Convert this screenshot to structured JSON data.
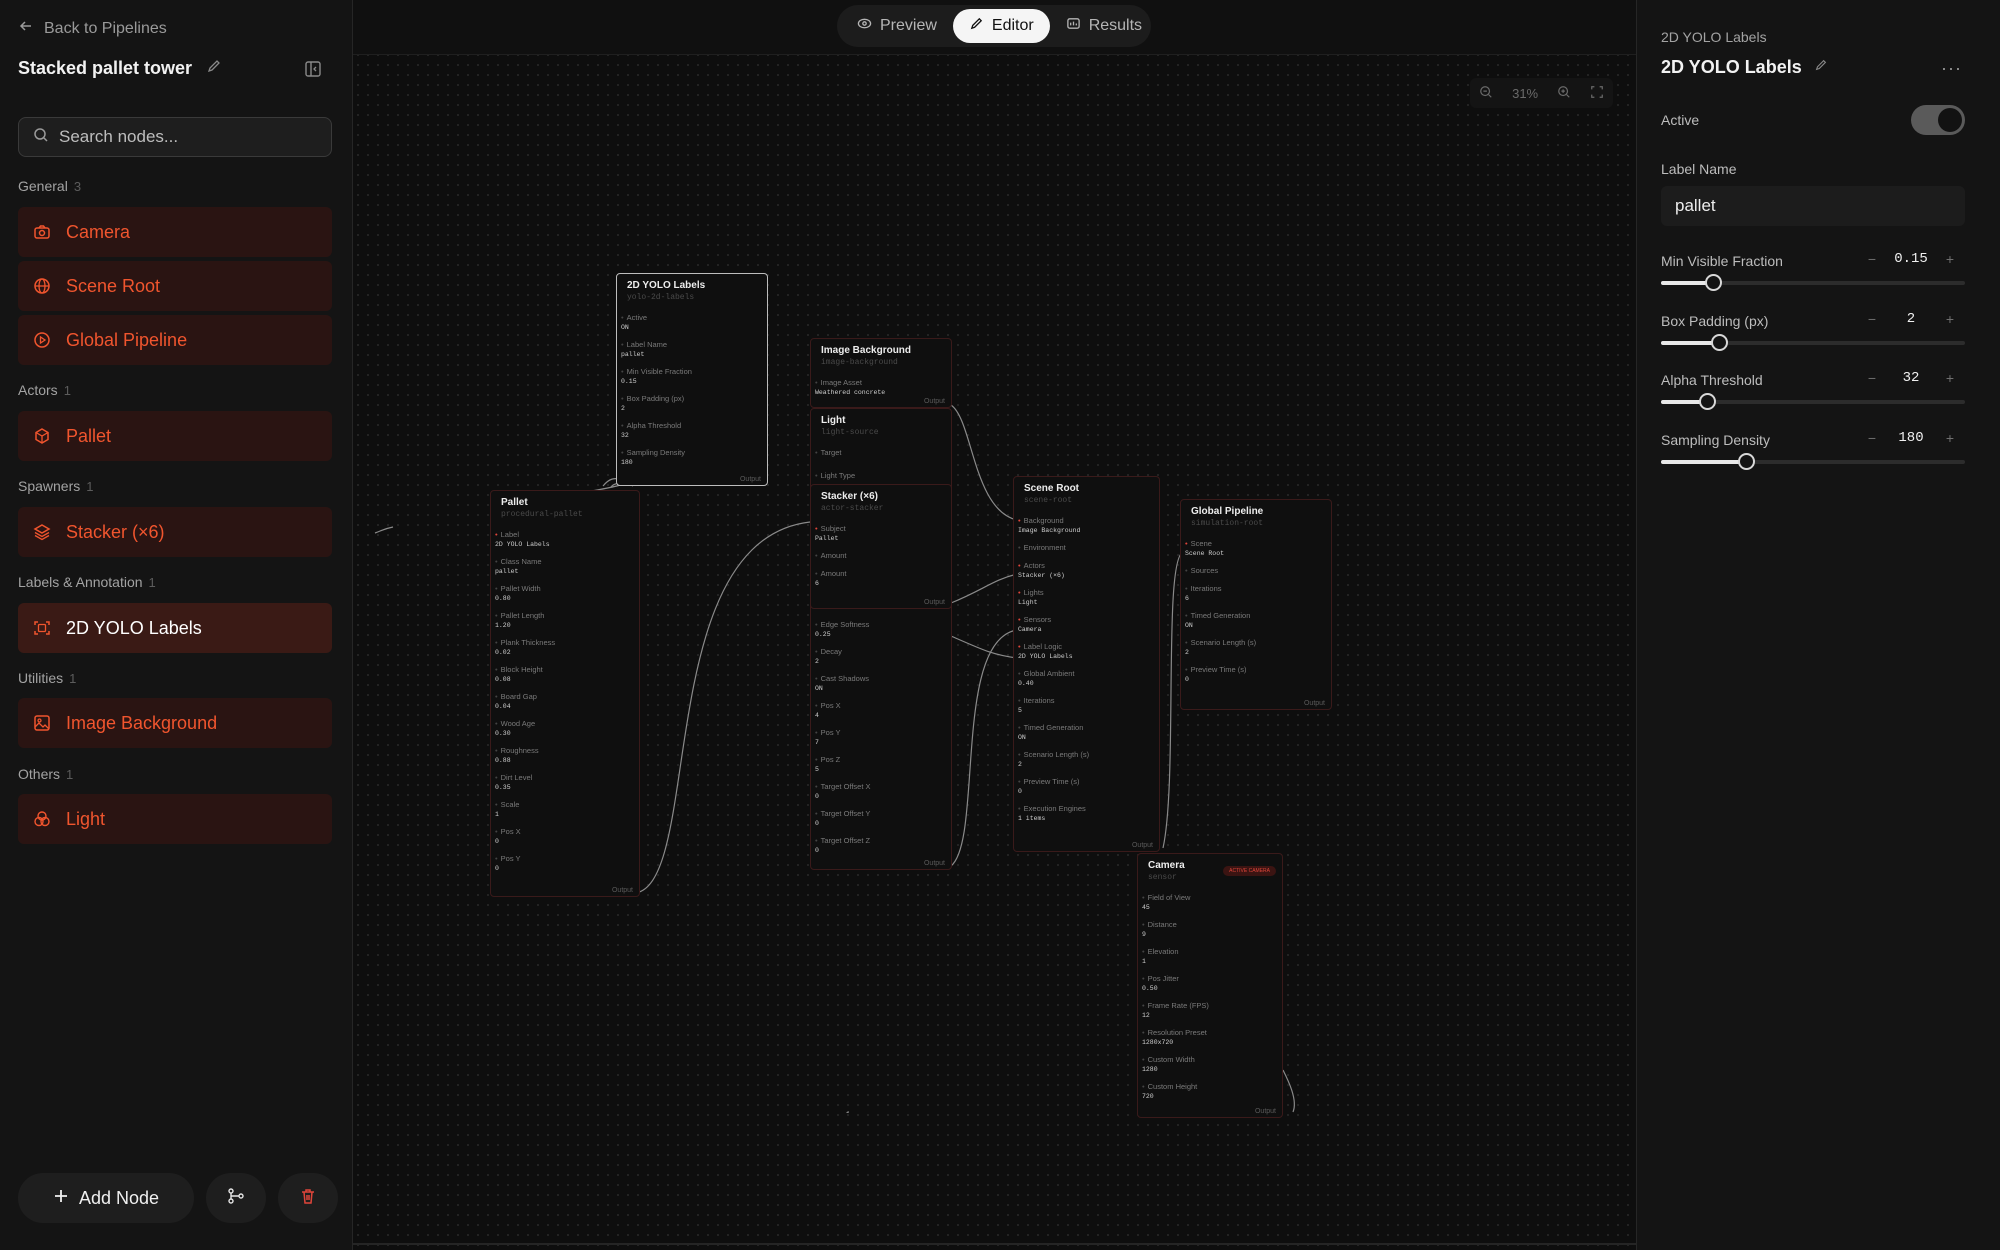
{
  "sidebar": {
    "back_label": "Back to Pipelines",
    "project_name": "Stacked pallet tower",
    "search_placeholder": "Search nodes...",
    "groups": [
      {
        "label": "General",
        "count": "3"
      },
      {
        "label": "Actors",
        "count": "1"
      },
      {
        "label": "Spawners",
        "count": "1"
      },
      {
        "label": "Labels & Annotation",
        "count": "1"
      },
      {
        "label": "Utilities",
        "count": "1"
      },
      {
        "label": "Others",
        "count": "1"
      }
    ],
    "items": [
      {
        "label": "Camera",
        "icon": "camera-icon"
      },
      {
        "label": "Scene Root",
        "icon": "globe-icon"
      },
      {
        "label": "Global Pipeline",
        "icon": "play-circle-icon"
      },
      {
        "label": "Pallet",
        "icon": "box-icon"
      },
      {
        "label": "Stacker (×6)",
        "icon": "layers-icon"
      },
      {
        "label": "2D YOLO Labels",
        "icon": "scan-icon"
      },
      {
        "label": "Image Background",
        "icon": "image-icon"
      },
      {
        "label": "Light",
        "icon": "circles-icon"
      }
    ],
    "add_node_label": "Add Node"
  },
  "toolbar": {
    "tabs": [
      {
        "label": "Preview",
        "icon": "eye-icon"
      },
      {
        "label": "Editor",
        "icon": "pencil-icon"
      },
      {
        "label": "Results",
        "icon": "results-icon"
      }
    ],
    "active_tab": "Editor",
    "zoom": "31%"
  },
  "graph": {
    "yolo": {
      "title": "2D YOLO Labels",
      "type": "yolo-2d-labels",
      "params": [
        [
          "Active",
          "ON"
        ],
        [
          "Label Name",
          "pallet"
        ],
        [
          "Min Visible Fraction",
          "0.15"
        ],
        [
          "Box Padding (px)",
          "2"
        ],
        [
          "Alpha Threshold",
          "32"
        ],
        [
          "Sampling Density",
          "180"
        ]
      ],
      "output": "Output"
    },
    "imgbg": {
      "title": "Image Background",
      "type": "image-background",
      "params": [
        [
          "Image Asset",
          "Weathered concrete"
        ]
      ],
      "output": "Output"
    },
    "light": {
      "title": "Light",
      "type": "light-source",
      "params": [
        [
          "Target",
          ""
        ],
        [
          "Light Type",
          ""
        ]
      ]
    },
    "stacker": {
      "title": "Stacker (×6)",
      "type": "actor-stacker",
      "params": [
        [
          "Subject",
          "Pallet"
        ],
        [
          "Amount",
          ""
        ],
        [
          "Amount",
          "6"
        ]
      ],
      "output": "Output"
    },
    "light_more": {
      "params": [
        [
          "Edge Softness",
          "0.25"
        ],
        [
          "Decay",
          "2"
        ],
        [
          "Cast Shadows",
          "ON"
        ],
        [
          "Pos X",
          "4"
        ],
        [
          "Pos Y",
          "7"
        ],
        [
          "Pos Z",
          "5"
        ],
        [
          "Target Offset X",
          "0"
        ],
        [
          "Target Offset Y",
          "0"
        ],
        [
          "Target Offset Z",
          "0"
        ]
      ],
      "output": "Output"
    },
    "pallet": {
      "title": "Pallet",
      "type": "procedural-pallet",
      "params": [
        [
          "Label",
          "2D YOLO Labels"
        ],
        [
          "Class Name",
          "pallet"
        ],
        [
          "Pallet Width",
          "0.80"
        ],
        [
          "Pallet Length",
          "1.20"
        ],
        [
          "Plank Thickness",
          "0.02"
        ],
        [
          "Block Height",
          "0.08"
        ],
        [
          "Board Gap",
          "0.04"
        ],
        [
          "Wood Age",
          "0.30"
        ],
        [
          "Roughness",
          "0.88"
        ],
        [
          "Dirt Level",
          "0.35"
        ],
        [
          "Scale",
          "1"
        ],
        [
          "Pos X",
          "0"
        ],
        [
          "Pos Y",
          "0"
        ]
      ],
      "output": "Output"
    },
    "scene": {
      "title": "Scene Root",
      "type": "scene-root",
      "params": [
        [
          "Background",
          "Image Background"
        ],
        [
          "Environment",
          ""
        ],
        [
          "Actors",
          "Stacker (×6)"
        ],
        [
          "Lights",
          "Light"
        ],
        [
          "Sensors",
          "Camera"
        ],
        [
          "Label Logic",
          "2D YOLO Labels"
        ],
        [
          "Global Ambient",
          "0.40"
        ],
        [
          "Iterations",
          "5"
        ],
        [
          "Timed Generation",
          "ON"
        ],
        [
          "Scenario Length (s)",
          "2"
        ],
        [
          "Preview Time (s)",
          "0"
        ],
        [
          "Execution Engines",
          "1 items"
        ]
      ],
      "output": "Output"
    },
    "global": {
      "title": "Global Pipeline",
      "type": "simulation-root",
      "params": [
        [
          "Scene",
          "Scene Root"
        ],
        [
          "Sources",
          ""
        ],
        [
          "Iterations",
          "6"
        ],
        [
          "Timed Generation",
          "ON"
        ],
        [
          "Scenario Length (s)",
          "2"
        ],
        [
          "Preview Time (s)",
          "0"
        ]
      ],
      "output": "Output"
    },
    "camera": {
      "title": "Camera",
      "type": "sensor",
      "badge": "ACTIVE CAMERA",
      "params": [
        [
          "Field of View",
          "45"
        ],
        [
          "Distance",
          "9"
        ],
        [
          "Elevation",
          "1"
        ],
        [
          "Pos Jitter",
          "0.50"
        ],
        [
          "Frame Rate (FPS)",
          "12"
        ],
        [
          "Resolution Preset",
          "1280x720"
        ],
        [
          "Custom Width",
          "1280"
        ],
        [
          "Custom Height",
          "720"
        ]
      ],
      "output": "Output"
    }
  },
  "inspector": {
    "subtitle": "2D YOLO Labels",
    "title": "2D YOLO Labels",
    "active_label": "Active",
    "active": true,
    "label_name_label": "Label Name",
    "label_name_value": "pallet",
    "fields": [
      {
        "label": "Min Visible Fraction",
        "value": "0.15",
        "level": 0.17
      },
      {
        "label": "Box Padding (px)",
        "value": "2",
        "level": 0.19
      },
      {
        "label": "Alpha Threshold",
        "value": "32",
        "level": 0.15
      },
      {
        "label": "Sampling Density",
        "value": "180",
        "level": 0.28
      }
    ]
  },
  "colors": {
    "accent": "#f0552e",
    "port_active": "#e0453a",
    "node_bg": "#2a1412"
  }
}
